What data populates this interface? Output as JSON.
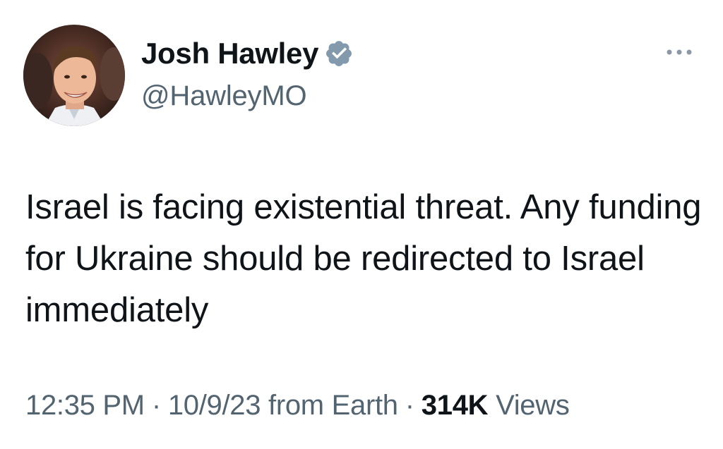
{
  "author": {
    "display_name": "Josh Hawley",
    "handle": "@HawleyMO",
    "verified": true,
    "verified_color": "#829aab"
  },
  "tweet": {
    "text": "Israel is facing existential threat. Any funding for Ukraine should be redirected to Israel immediately"
  },
  "meta": {
    "time": "12:35 PM",
    "separator": "·",
    "date": "10/9/23",
    "source": "from Earth",
    "views_count": "314K",
    "views_label": "Views"
  },
  "colors": {
    "text_primary": "#0f1419",
    "text_secondary": "#536471",
    "background": "#ffffff"
  },
  "icons": {
    "verified": "verified-badge-icon",
    "more": "more-horizontal-icon"
  }
}
